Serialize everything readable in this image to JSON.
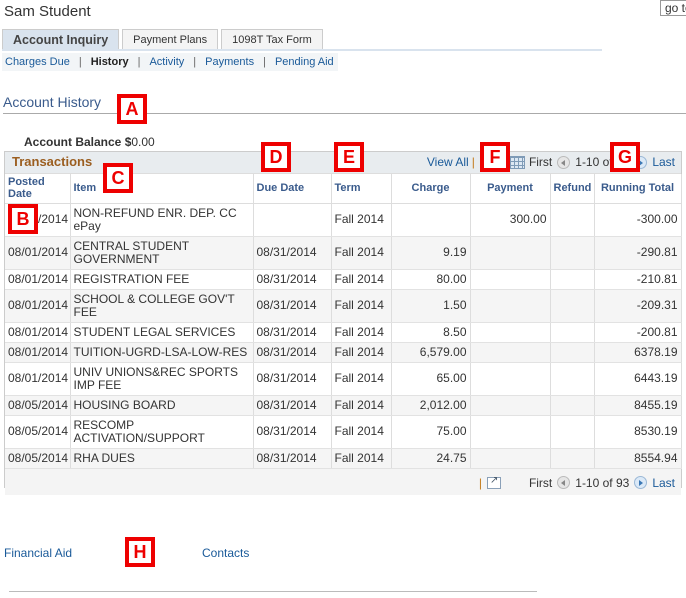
{
  "header": {
    "student_name": "Sam Student",
    "goto_label": "go to"
  },
  "tabs": [
    {
      "label": "Account Inquiry",
      "active": true
    },
    {
      "label": "Payment Plans",
      "active": false
    },
    {
      "label": "1098T Tax Form",
      "active": false
    }
  ],
  "subnav": [
    {
      "label": "Charges Due",
      "current": false
    },
    {
      "label": "History",
      "current": true
    },
    {
      "label": "Activity",
      "current": false
    },
    {
      "label": "Payments",
      "current": false
    },
    {
      "label": "Pending Aid",
      "current": false
    }
  ],
  "page": {
    "title": "Account History",
    "balance_label": "Account Balance $",
    "balance_value": "0.00"
  },
  "grid": {
    "title": "Transactions",
    "view_all": "View All",
    "first": "First",
    "range": "1-10 of 93",
    "last": "Last",
    "columns": [
      "Posted Date",
      "Item",
      "Due Date",
      "Term",
      "Charge",
      "Payment",
      "Refund",
      "Running Total"
    ],
    "rows": [
      {
        "posted": "08/01/2014",
        "item": "NON-REFUND ENR. DEP. CC ePay",
        "due": "",
        "term": "Fall 2014",
        "charge": "",
        "payment": "300.00",
        "refund": "",
        "total": "-300.00"
      },
      {
        "posted": "08/01/2014",
        "item": "CENTRAL STUDENT GOVERNMENT",
        "due": "08/31/2014",
        "term": "Fall 2014",
        "charge": "9.19",
        "payment": "",
        "refund": "",
        "total": "-290.81"
      },
      {
        "posted": "08/01/2014",
        "item": "REGISTRATION FEE",
        "due": "08/31/2014",
        "term": "Fall 2014",
        "charge": "80.00",
        "payment": "",
        "refund": "",
        "total": "-210.81"
      },
      {
        "posted": "08/01/2014",
        "item": "SCHOOL & COLLEGE GOV'T FEE",
        "due": "08/31/2014",
        "term": "Fall 2014",
        "charge": "1.50",
        "payment": "",
        "refund": "",
        "total": "-209.31"
      },
      {
        "posted": "08/01/2014",
        "item": "STUDENT LEGAL SERVICES",
        "due": "08/31/2014",
        "term": "Fall 2014",
        "charge": "8.50",
        "payment": "",
        "refund": "",
        "total": "-200.81"
      },
      {
        "posted": "08/01/2014",
        "item": "TUITION-UGRD-LSA-LOW-RES",
        "due": "08/31/2014",
        "term": "Fall 2014",
        "charge": "6,579.00",
        "payment": "",
        "refund": "",
        "total": "6378.19"
      },
      {
        "posted": "08/01/2014",
        "item": "UNIV UNIONS&REC SPORTS IMP FEE",
        "due": "08/31/2014",
        "term": "Fall 2014",
        "charge": "65.00",
        "payment": "",
        "refund": "",
        "total": "6443.19"
      },
      {
        "posted": "08/05/2014",
        "item": "HOUSING BOARD",
        "due": "08/31/2014",
        "term": "Fall 2014",
        "charge": "2,012.00",
        "payment": "",
        "refund": "",
        "total": "8455.19"
      },
      {
        "posted": "08/05/2014",
        "item": "RESCOMP ACTIVATION/SUPPORT",
        "due": "08/31/2014",
        "term": "Fall 2014",
        "charge": "75.00",
        "payment": "",
        "refund": "",
        "total": "8530.19"
      },
      {
        "posted": "08/05/2014",
        "item": "RHA DUES",
        "due": "08/31/2014",
        "term": "Fall 2014",
        "charge": "24.75",
        "payment": "",
        "refund": "",
        "total": "8554.94"
      }
    ]
  },
  "bottom_links": [
    "Financial Aid",
    "Contacts"
  ],
  "markers": [
    "A",
    "B",
    "C",
    "D",
    "E",
    "F",
    "G",
    "H"
  ]
}
